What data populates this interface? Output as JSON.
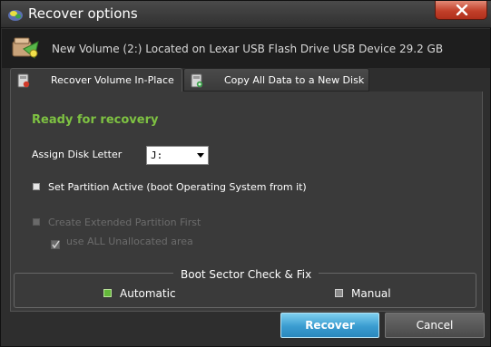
{
  "window": {
    "title": "Recover options",
    "title_icon": "app-logo-icon",
    "close_icon": "close-icon"
  },
  "drive": {
    "title": "New Volume (2:) Located on Lexar USB Flash Drive USB Device 29.2 GB",
    "icon": "drive-recover-icon"
  },
  "tabs": [
    {
      "label": "Recover Volume In-Place",
      "icon": "drive-inplace-icon",
      "active": true
    },
    {
      "label": "Copy All Data to a New Disk",
      "icon": "drive-copy-icon",
      "active": false
    }
  ],
  "panel": {
    "status": "Ready for recovery",
    "status_color": "#7ec242",
    "assign_label": "Assign Disk Letter",
    "disk_letter": "J:",
    "set_active_label": "Set Partition Active (boot Operating System from it)",
    "set_active_checked": false,
    "extended_label": "Create Extended Partition First",
    "extended_enabled": false,
    "unallocated_label": "use ALL Unallocated area",
    "unallocated_checked": true,
    "unallocated_enabled": false
  },
  "boot_sector": {
    "legend": "Boot Sector Check & Fix",
    "options": [
      {
        "label": "Automatic",
        "selected": true
      },
      {
        "label": "Manual",
        "selected": false
      }
    ]
  },
  "buttons": {
    "recover": "Recover",
    "cancel": "Cancel"
  },
  "colors": {
    "accent": "#3a9cd0",
    "selected_radio": "#63b83a"
  }
}
